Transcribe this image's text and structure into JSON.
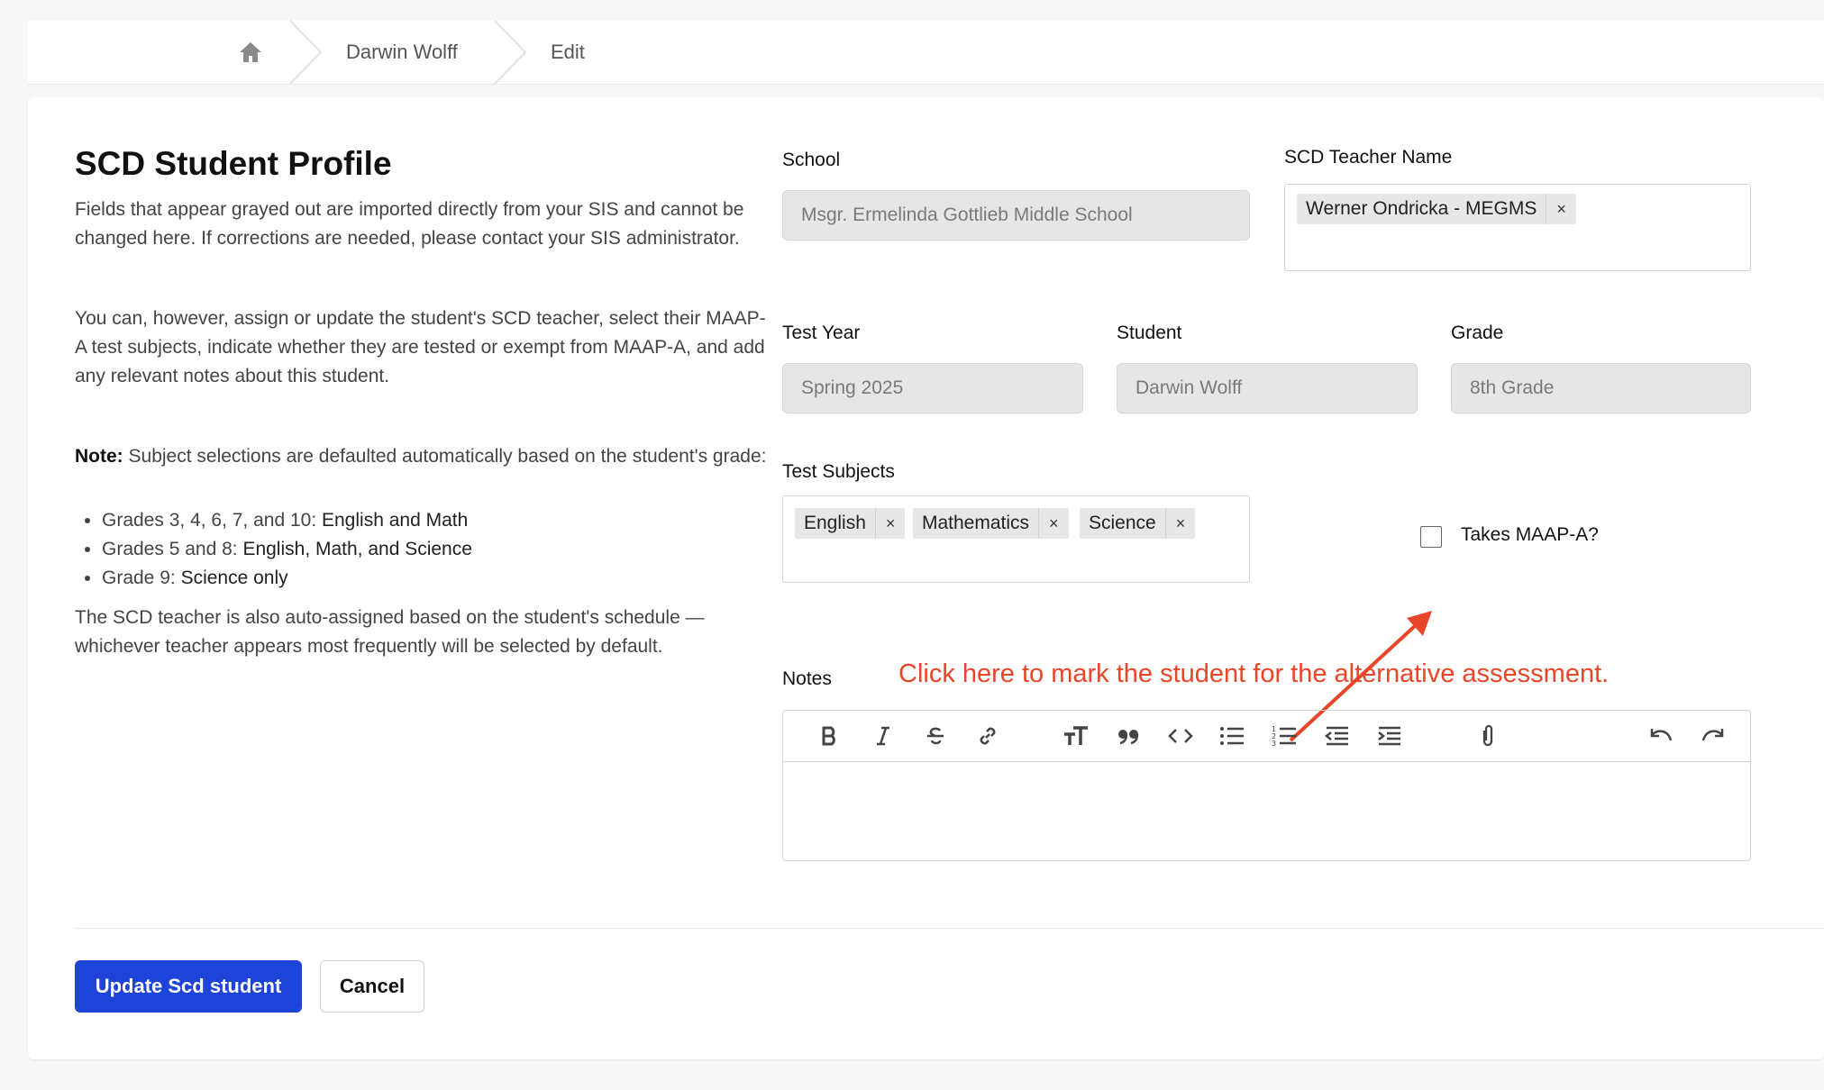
{
  "breadcrumb": {
    "home_icon": "home-icon",
    "items": [
      "Darwin Wolff",
      "Edit"
    ]
  },
  "intro": {
    "title": "SCD Student Profile",
    "p1": "Fields that appear grayed out are imported directly from your SIS and cannot be changed here. If corrections are needed, please contact your SIS administrator.",
    "p2": "You can, however, assign or update the student's SCD teacher, select their MAAP-A test subjects, indicate whether they are tested or exempt from MAAP-A, and add any relevant notes about this student.",
    "note_label": "Note:",
    "note_text": " Subject selections are defaulted automatically based on the student's grade:",
    "rules": [
      {
        "prefix": "Grades 3, 4, 6, 7, and 10: ",
        "value": "English and Math"
      },
      {
        "prefix": "Grades 5 and 8: ",
        "value": "English, Math, and Science"
      },
      {
        "prefix": "Grade 9: ",
        "value": "Science only"
      }
    ],
    "p3": "The SCD teacher is also auto-assigned based on the student's schedule — whichever teacher appears most frequently will be selected by default."
  },
  "form": {
    "school_label": "School",
    "school_value": "Msgr. Ermelinda Gottlieb Middle School",
    "teacher_label": "SCD Teacher Name",
    "teacher_tags": [
      "Werner Ondricka - MEGMS"
    ],
    "test_year_label": "Test Year",
    "test_year_value": "Spring 2025",
    "student_label": "Student",
    "student_value": "Darwin Wolff",
    "grade_label": "Grade",
    "grade_value": "8th Grade",
    "subjects_label": "Test Subjects",
    "subject_tags": [
      "English",
      "Mathematics",
      "Science"
    ],
    "tag_remove": "×",
    "maap_label": "Takes MAAP-A?",
    "maap_checked": false,
    "notes_label": "Notes"
  },
  "annotation": {
    "text": "Click here to mark the student for the alternative assessment.",
    "color": "#e8452a"
  },
  "toolbar_icons": [
    "bold-icon",
    "italic-icon",
    "strikethrough-icon",
    "link-icon",
    "heading-icon",
    "quote-icon",
    "code-icon",
    "bullet-list-icon",
    "numbered-list-icon",
    "outdent-icon",
    "indent-icon",
    "attach-icon",
    "undo-icon",
    "redo-icon"
  ],
  "actions": {
    "submit_label": "Update Scd student",
    "cancel_label": "Cancel",
    "primary_color": "#1d43d8"
  }
}
